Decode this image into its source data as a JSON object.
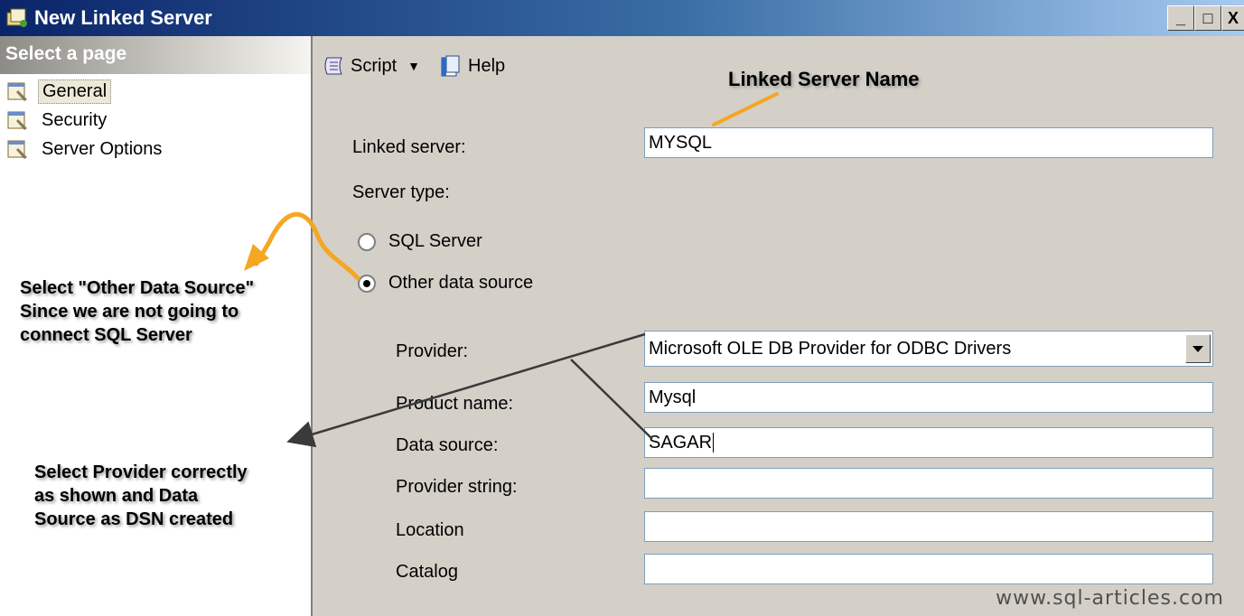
{
  "window": {
    "title": "New Linked Server",
    "minimize_glyph": "_",
    "maximize_glyph": "□",
    "close_glyph": "X"
  },
  "sidebar": {
    "header": "Select a page",
    "items": [
      {
        "label": "General",
        "icon": "page-wrench-icon",
        "selected": true
      },
      {
        "label": "Security",
        "icon": "page-wrench-icon"
      },
      {
        "label": "Server Options",
        "icon": "page-wrench-icon"
      }
    ]
  },
  "toolbar": {
    "script_label": "Script",
    "help_label": "Help"
  },
  "form": {
    "linked_server_label": "Linked server:",
    "linked_server_value": "MYSQL",
    "server_type_label": "Server type:",
    "radio_sql_server": "SQL Server",
    "radio_other": "Other data source",
    "provider_label": "Provider:",
    "provider_value": "Microsoft OLE DB Provider for ODBC Drivers",
    "product_name_label": "Product name:",
    "product_name_value": "Mysql",
    "data_source_label": "Data source:",
    "data_source_value": "SAGAR",
    "provider_string_label": "Provider string:",
    "provider_string_value": "",
    "location_label": "Location",
    "location_value": "",
    "catalog_label": "Catalog",
    "catalog_value": ""
  },
  "annotations": {
    "linked_server_name": "Linked Server Name",
    "other_ds_line1": "Select \"Other Data Source\"",
    "other_ds_line2": "Since we are not going to",
    "other_ds_line3": "connect SQL Server",
    "provider_line1": "Select Provider correctly",
    "provider_line2": "as shown and Data",
    "provider_line3": "Source as DSN created"
  },
  "watermark": "www.sql-articles.com",
  "colors": {
    "title_start": "#0a246a",
    "title_end": "#a6caf0",
    "panel": "#d4d0c8",
    "orange_arrow": "#f5a623",
    "dark_arrow": "#3a3a3a"
  }
}
